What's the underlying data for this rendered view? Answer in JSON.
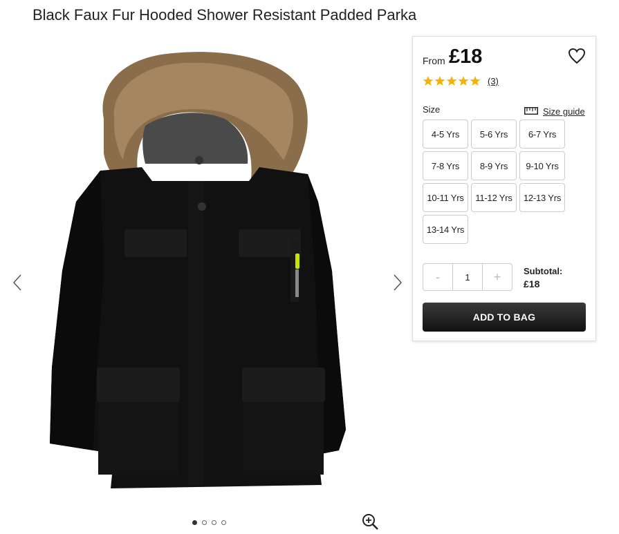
{
  "product": {
    "title": "Black Faux Fur Hooded Shower Resistant Padded Parka",
    "from_label": "From",
    "price": "£18",
    "rating": 5,
    "review_count": "(3)"
  },
  "sizes": {
    "label": "Size",
    "guide_label": "Size guide",
    "options": [
      "4-5 Yrs",
      "5-6 Yrs",
      "6-7 Yrs",
      "7-8 Yrs",
      "8-9 Yrs",
      "9-10 Yrs",
      "10-11 Yrs",
      "11-12 Yrs",
      "12-13 Yrs",
      "13-14 Yrs"
    ]
  },
  "quantity": {
    "minus": "-",
    "value": "1",
    "plus": "+"
  },
  "subtotal": {
    "label": "Subtotal:",
    "value": "£18"
  },
  "cart": {
    "add_label": "ADD TO BAG"
  },
  "gallery": {
    "image_count": 4,
    "active_index": 0
  },
  "icons": [
    "chevron-left-icon",
    "chevron-right-icon",
    "heart-icon",
    "star-icon",
    "ruler-icon",
    "zoom-in-icon"
  ],
  "colors": {
    "star": "#f5b301",
    "button": "#1a1a1a"
  }
}
